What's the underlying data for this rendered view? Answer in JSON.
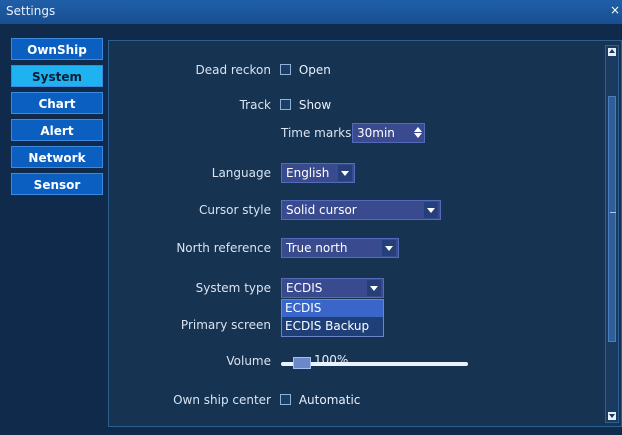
{
  "window": {
    "title": "Settings",
    "close_symbol": "×"
  },
  "sidebar": {
    "items": [
      {
        "label": "OwnShip",
        "active": false
      },
      {
        "label": "System",
        "active": true
      },
      {
        "label": "Chart",
        "active": false
      },
      {
        "label": "Alert",
        "active": false
      },
      {
        "label": "Network",
        "active": false
      },
      {
        "label": "Sensor",
        "active": false
      }
    ]
  },
  "settings": {
    "dead_reckon": {
      "label": "Dead reckon",
      "checkbox_label": "Open",
      "checked": false
    },
    "track": {
      "label": "Track",
      "checkbox_label": "Show",
      "checked": false
    },
    "time_marks": {
      "label": "Time marks",
      "value": "30min"
    },
    "language": {
      "label": "Language",
      "value": "English"
    },
    "cursor_style": {
      "label": "Cursor style",
      "value": "Solid cursor"
    },
    "north_reference": {
      "label": "North reference",
      "value": "True north"
    },
    "system_type": {
      "label": "System type",
      "value": "ECDIS",
      "options": [
        "ECDIS",
        "ECDIS Backup"
      ],
      "highlighted_option": "ECDIS"
    },
    "primary_screen": {
      "label": "Primary screen"
    },
    "volume": {
      "label": "Volume",
      "value_text": "100%",
      "value_percent": 100
    },
    "own_ship_center": {
      "label": "Own ship center",
      "checkbox_label": "Automatic",
      "checked": false
    }
  },
  "colors": {
    "accent": "#1fb2f0",
    "panel_bg": "#163352",
    "control_bg": "#3a4a8f"
  }
}
